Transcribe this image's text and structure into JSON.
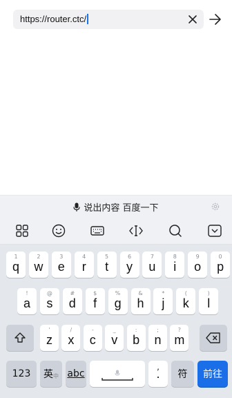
{
  "address_bar": {
    "url": "https://router.ctc/",
    "clear_icon": "close-icon",
    "go_icon": "arrow-right-icon"
  },
  "voice_search": {
    "label": "说出内容 百度一下",
    "mic_icon": "microphone-icon",
    "settings_icon": "gear-icon"
  },
  "toolbar": {
    "items": [
      "grid-icon",
      "emoji-icon",
      "keyboard-icon",
      "cursor-move-icon",
      "search-icon",
      "collapse-keyboard-icon"
    ]
  },
  "keyboard": {
    "row1": [
      {
        "main": "q",
        "sub": "1"
      },
      {
        "main": "w",
        "sub": "2"
      },
      {
        "main": "e",
        "sub": "3"
      },
      {
        "main": "r",
        "sub": "4"
      },
      {
        "main": "t",
        "sub": "5"
      },
      {
        "main": "y",
        "sub": "6"
      },
      {
        "main": "u",
        "sub": "7"
      },
      {
        "main": "i",
        "sub": "8"
      },
      {
        "main": "o",
        "sub": "9"
      },
      {
        "main": "p",
        "sub": "0"
      }
    ],
    "row2": [
      {
        "main": "a",
        "sub": "!"
      },
      {
        "main": "s",
        "sub": "@"
      },
      {
        "main": "d",
        "sub": "#"
      },
      {
        "main": "f",
        "sub": "$"
      },
      {
        "main": "g",
        "sub": "%"
      },
      {
        "main": "h",
        "sub": "&"
      },
      {
        "main": "j",
        "sub": "*"
      },
      {
        "main": "k",
        "sub": "("
      },
      {
        "main": "l",
        "sub": ")"
      }
    ],
    "row3": [
      {
        "main": "z",
        "sub": "'"
      },
      {
        "main": "x",
        "sub": "/"
      },
      {
        "main": "c",
        "sub": "-"
      },
      {
        "main": "v",
        "sub": "_"
      },
      {
        "main": "b",
        "sub": ":"
      },
      {
        "main": "n",
        "sub": ";"
      },
      {
        "main": "m",
        "sub": "?"
      }
    ],
    "shift_icon": "shift-icon",
    "backspace_icon": "backspace-icon",
    "num_label": "123",
    "lang_label": "英",
    "lang_sub": "中",
    "abc_label": "abc",
    "space_icon": "microphone-icon",
    "period_sub": ",",
    "period_main": ".",
    "symbol_label": "符",
    "enter_label": "前往",
    "enter_color": "#1a6fe8"
  }
}
